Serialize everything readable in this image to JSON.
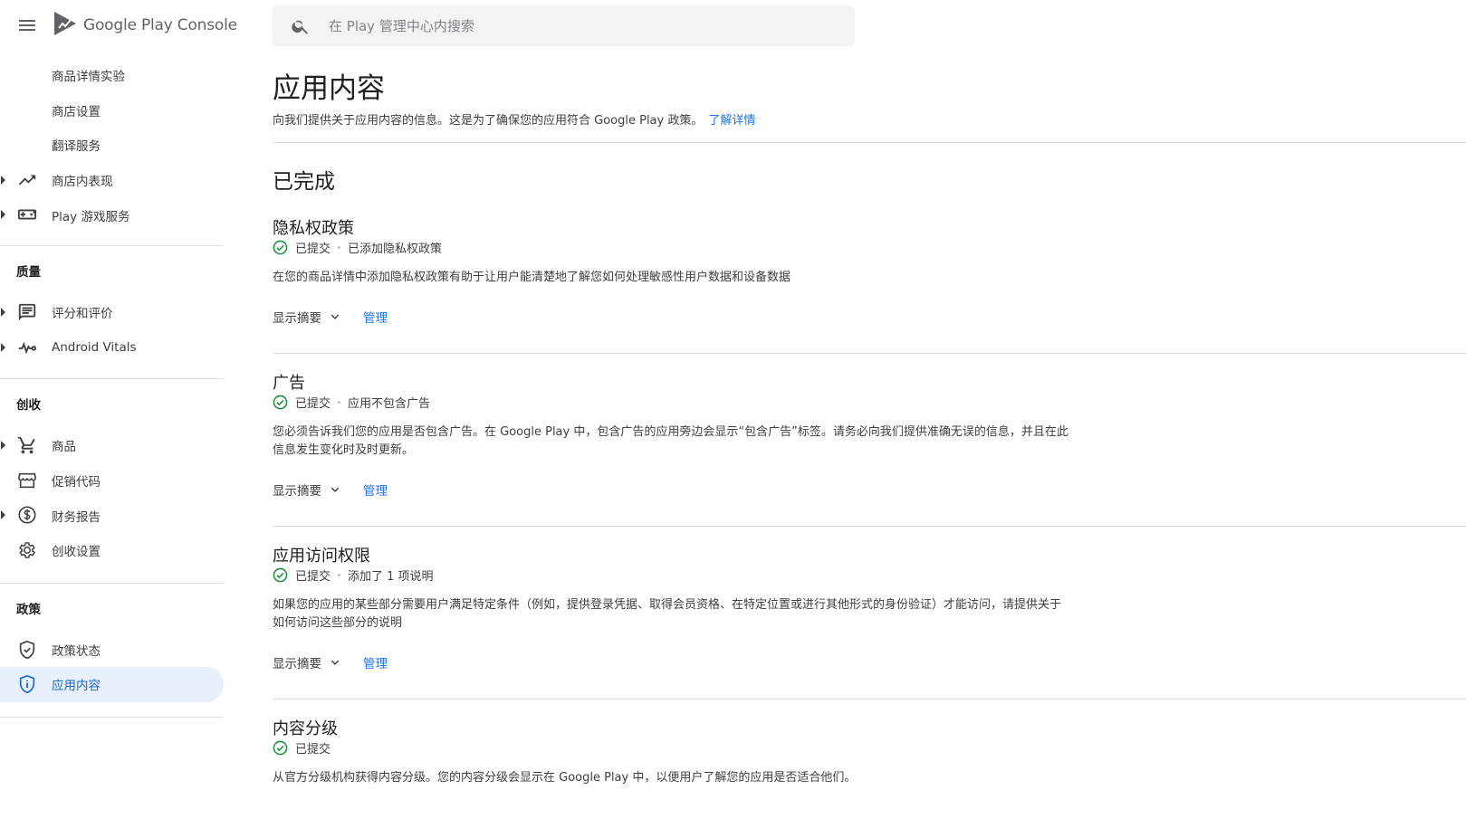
{
  "header": {
    "app_title": "Google Play Console",
    "search_placeholder": "在 Play 管理中心内搜索"
  },
  "sidebar": {
    "store_items": [
      {
        "label": "商品详情实验"
      },
      {
        "label": "商店设置"
      },
      {
        "label": "翻译服务"
      }
    ],
    "store_performance": "商店内表现",
    "play_games": "Play 游戏服务",
    "quality_section": "质量",
    "quality_items": [
      {
        "label": "评分和评价",
        "icon": "rating-icon"
      },
      {
        "label": "Android Vitals",
        "icon": "vitals-icon"
      }
    ],
    "monetize_section": "创收",
    "monetize_items": [
      {
        "label": "商品",
        "icon": "cart-icon"
      },
      {
        "label": "促销代码",
        "icon": "store-icon"
      },
      {
        "label": "财务报告",
        "icon": "dollar-icon"
      },
      {
        "label": "创收设置",
        "icon": "gear-icon"
      }
    ],
    "policy_section": "政策",
    "policy_items": [
      {
        "label": "政策状态",
        "icon": "shield-check-icon"
      },
      {
        "label": "应用内容",
        "icon": "shield-info-icon",
        "active": true
      }
    ]
  },
  "main": {
    "title": "应用内容",
    "subtitle": "向我们提供关于应用内容的信息。这是为了确保您的应用符合 Google Play 政策。",
    "learn_more": "了解详情",
    "completed_heading": "已完成",
    "show_summary_label": "显示摘要",
    "manage_label": "管理",
    "cards": [
      {
        "title": "隐私权政策",
        "status": "已提交",
        "detail": "已添加隐私权政策",
        "description": "在您的商品详情中添加隐私权政策有助于让用户能清楚地了解您如何处理敏感性用户数据和设备数据"
      },
      {
        "title": "广告",
        "status": "已提交",
        "detail": "应用不包含广告",
        "description": "您必须告诉我们您的应用是否包含广告。在 Google Play 中，包含广告的应用旁边会显示“包含广告”标签。请务必向我们提供准确无误的信息，并且在此信息发生变化时及时更新。"
      },
      {
        "title": "应用访问权限",
        "status": "已提交",
        "detail": "添加了 1 项说明",
        "description": "如果您的应用的某些部分需要用户满足特定条件（例如，提供登录凭据、取得会员资格、在特定位置或进行其他形式的身份验证）才能访问，请提供关于如何访问这些部分的说明"
      },
      {
        "title": "内容分级",
        "status": "已提交",
        "detail": "",
        "description": "从官方分级机构获得内容分级。您的内容分级会显示在 Google Play 中，以便用户了解您的应用是否适合他们。"
      }
    ]
  },
  "colors": {
    "accent": "#1a73e8",
    "success": "#1e8e3e",
    "active_bg": "#e8f0fe"
  }
}
